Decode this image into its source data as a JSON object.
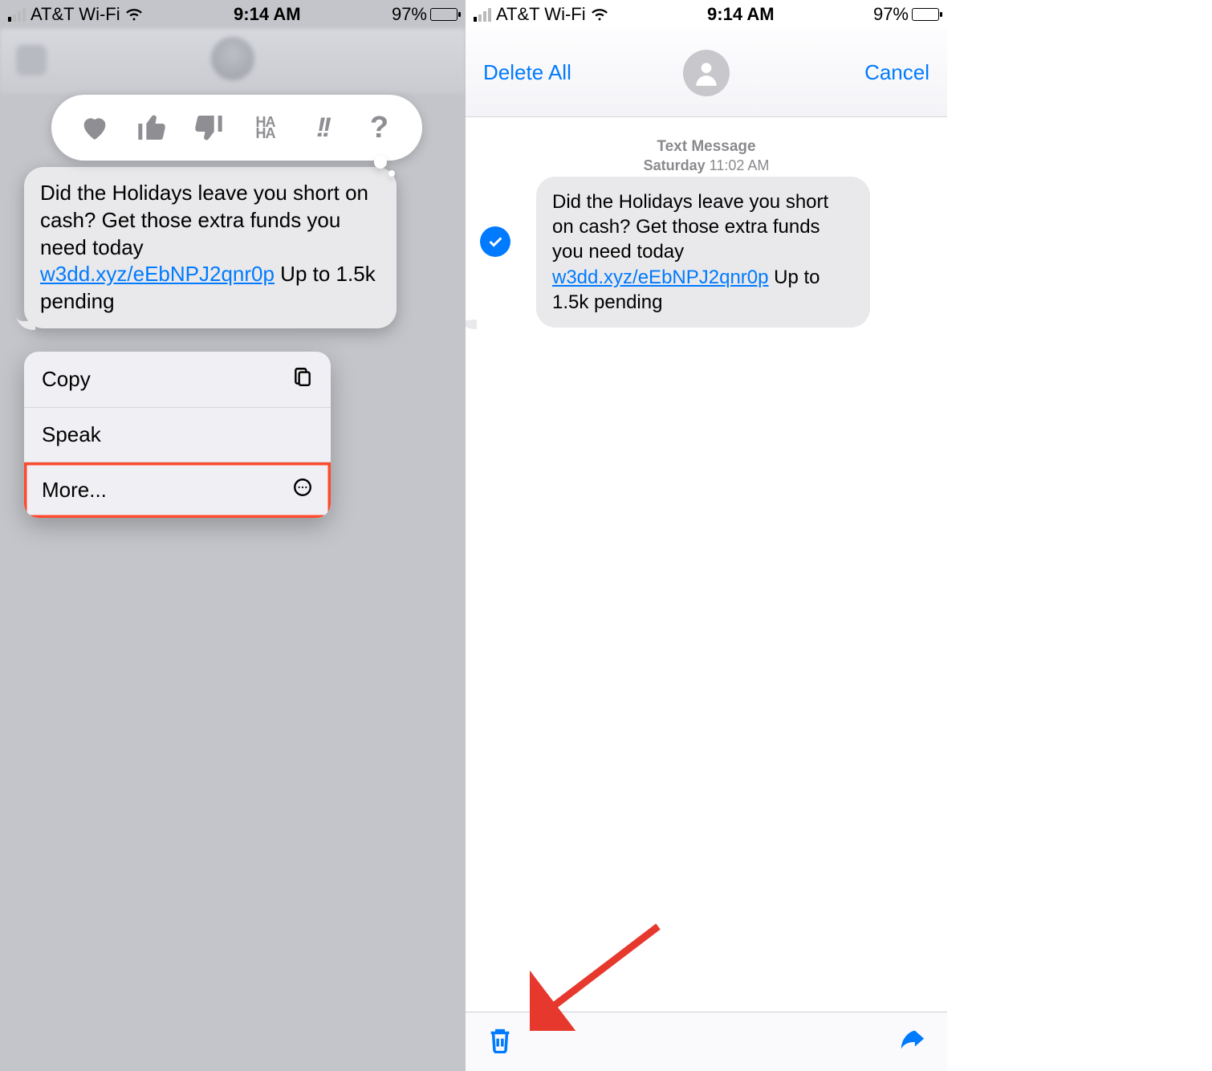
{
  "status": {
    "carrier": "AT&T Wi-Fi",
    "time": "9:14 AM",
    "battery_pct": "97%",
    "active_bars": 1
  },
  "left_screen": {
    "message": {
      "text_before_link": "Did the Holidays leave you short on cash? Get those extra funds you need today ",
      "link_text": "w3dd.xyz/eEbNPJ2qnr0p",
      "text_after_link": " Up to 1.5k pending"
    },
    "tapbacks": {
      "heart": "heart",
      "thumbs_up": "thumbs-up",
      "thumbs_down": "thumbs-down",
      "haha": "HA HA",
      "exclaim": "!!",
      "question": "?"
    },
    "context_menu": {
      "copy": "Copy",
      "speak": "Speak",
      "more": "More..."
    }
  },
  "right_screen": {
    "nav": {
      "delete_all": "Delete All",
      "cancel": "Cancel"
    },
    "meta": {
      "label": "Text Message",
      "day": "Saturday",
      "time": "11:02 AM"
    },
    "message": {
      "text_before_link": "Did the Holidays leave you short on cash? Get those extra funds you need today ",
      "link_text": "w3dd.xyz/eEbNPJ2qnr0p",
      "text_after_link": " Up to 1.5k pending"
    },
    "toolbar": {
      "trash": "trash",
      "share": "share"
    }
  }
}
